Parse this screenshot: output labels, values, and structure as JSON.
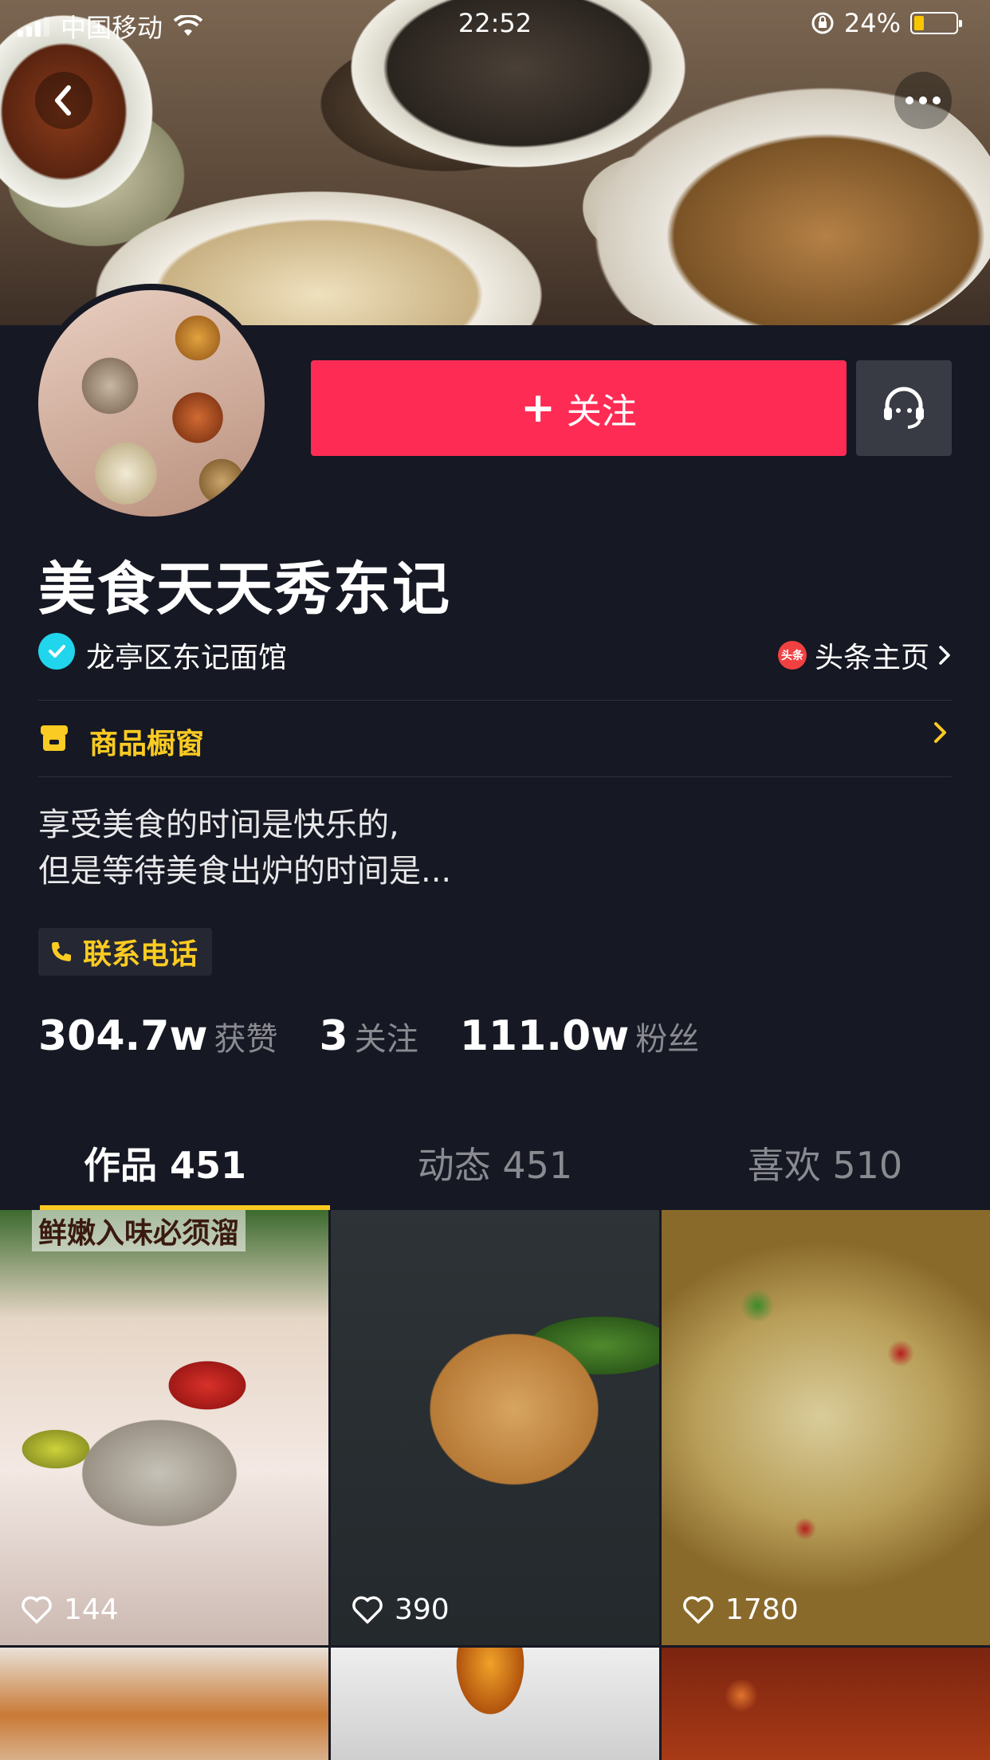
{
  "status_bar": {
    "carrier": "中国移动",
    "time": "22:52",
    "battery": "24%",
    "battery_level": 0.24
  },
  "header": {
    "back_icon": "chevron-left-icon",
    "more_icon": "more-dots-icon"
  },
  "profile": {
    "follow_label": "关注",
    "name": "美食天天秀东记",
    "verified_text": "龙亭区东记面馆",
    "toutiao_label": "头条主页",
    "toutiao_badge": "头条",
    "shop_label": "商品橱窗",
    "bio_line1": "享受美食的时间是快乐的,",
    "bio_line2": "但是等待美食出炉的时间是...",
    "contact_label": "联系电话"
  },
  "stats": [
    {
      "value": "304.7w",
      "label": "获赞"
    },
    {
      "value": "3",
      "label": "关注"
    },
    {
      "value": "111.0w",
      "label": "粉丝"
    }
  ],
  "tabs": [
    {
      "label": "作品 451",
      "active": true
    },
    {
      "label": "动态 451",
      "active": false
    },
    {
      "label": "喜欢 510",
      "active": false
    }
  ],
  "videos": [
    {
      "likes": "144",
      "overlay_text": "鲜嫩入味必须溜"
    },
    {
      "likes": "390"
    },
    {
      "likes": "1780"
    }
  ],
  "colors": {
    "accent": "#fe2c55",
    "background": "#161823",
    "highlight": "#facb22",
    "verified": "#20d5ec"
  }
}
